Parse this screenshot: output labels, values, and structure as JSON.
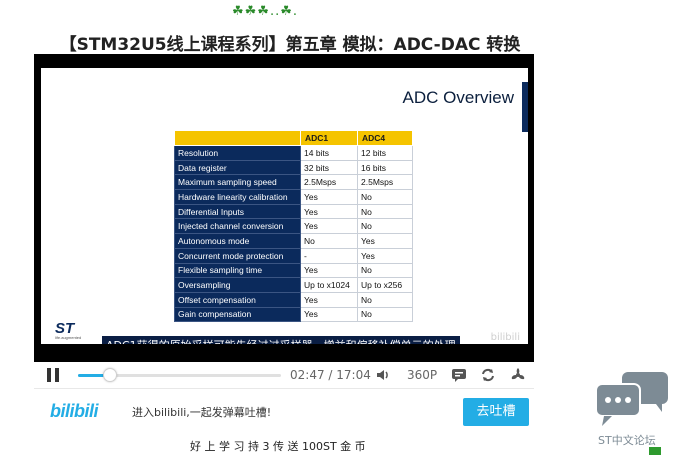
{
  "page": {
    "decoration": "☘☘☘..☘.",
    "title": "【STM32U5线上课程系列】第五章 模拟：ADC-DAC 转换"
  },
  "video": {
    "slide": {
      "title": "ADC Overview",
      "table": {
        "headers": [
          "",
          "ADC1",
          "ADC4"
        ],
        "rows": [
          [
            "Resolution",
            "14 bits",
            "12 bits"
          ],
          [
            "Data register",
            "32 bits",
            "16 bits"
          ],
          [
            "Maximum sampling speed",
            "2.5Msps",
            "2.5Msps"
          ],
          [
            "Hardware linearity calibration",
            "Yes",
            "No"
          ],
          [
            "Differential Inputs",
            "Yes",
            "No"
          ],
          [
            "Injected channel conversion",
            "Yes",
            "No"
          ],
          [
            "Autonomous mode",
            "No",
            "Yes"
          ],
          [
            "Concurrent mode protection",
            "-",
            "Yes"
          ],
          [
            "Flexible sampling time",
            "Yes",
            "No"
          ],
          [
            "Oversampling",
            "Up to x1024",
            "Up to x256"
          ],
          [
            "Offset compensation",
            "Yes",
            "No"
          ],
          [
            "Gain compensation",
            "Yes",
            "No"
          ]
        ]
      },
      "logo": "ST",
      "logo_sub": "life.augmented",
      "watermark": "bilibili"
    },
    "subtitle": "ADC1获得的原始采样可能先经过过采样器、增益和偏移补偿单元的处理"
  },
  "controls": {
    "progress": 0.16,
    "current_time": "02:47",
    "total_time": "17:04",
    "quality": "360P",
    "icons": [
      "pause-icon",
      "volume-icon",
      "danmaku-icon",
      "loop-icon",
      "fan-icon"
    ]
  },
  "chat": {
    "logo": "bilibili",
    "placeholder": "进入bilibili,一起发弹幕吐槽!",
    "send_label": "去吐槽"
  },
  "below": {
    "text": "好 上 学 习 持 3 传 送 100ST 金 币"
  },
  "forum": {
    "label": "ST中文论坛"
  },
  "colors": {
    "accent": "#23ade5",
    "header_yellow": "#f5c400",
    "table_navy": "#0b2a5c"
  }
}
